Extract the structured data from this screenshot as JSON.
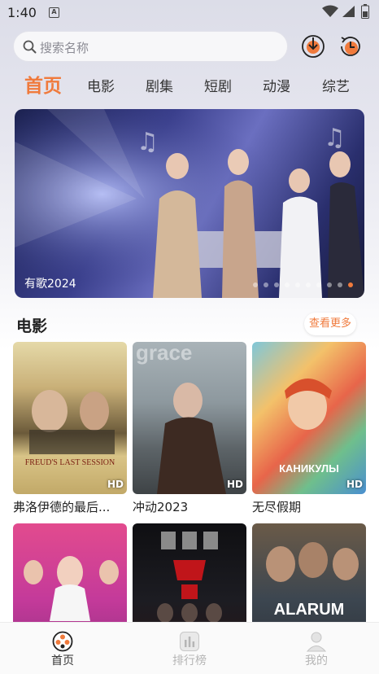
{
  "status_bar": {
    "time": "1:40",
    "notification_icon": "A"
  },
  "search": {
    "placeholder": "搜索名称"
  },
  "header_buttons": [
    "download-icon",
    "history-icon"
  ],
  "tabs": [
    {
      "label": "首页",
      "active": true
    },
    {
      "label": "电影"
    },
    {
      "label": "剧集"
    },
    {
      "label": "短剧"
    },
    {
      "label": "动漫"
    },
    {
      "label": "综艺"
    }
  ],
  "banner": {
    "title": "有歌2024",
    "dot_count": 10,
    "active_dot": 9
  },
  "section": {
    "title": "电影",
    "more_label": "查看更多"
  },
  "movies": [
    {
      "title": "弗洛伊德的最后...",
      "badge": "HD",
      "poster_text": "FREUD'S LAST SESSION"
    },
    {
      "title": "冲动2023",
      "badge": "HD",
      "poster_text": "grace"
    },
    {
      "title": "无尽假期",
      "badge": "HD",
      "poster_text": "КАНИКУЛЫ"
    },
    {
      "title": "",
      "badge": ""
    },
    {
      "title": "",
      "badge": ""
    },
    {
      "title": "",
      "badge": "",
      "poster_text": "ALARUM"
    }
  ],
  "bottom_nav": [
    {
      "label": "首页",
      "icon": "film-reel-icon",
      "active": true
    },
    {
      "label": "排行榜",
      "icon": "chart-icon"
    },
    {
      "label": "我的",
      "icon": "user-icon"
    }
  ],
  "colors": {
    "accent": "#f07a3c"
  }
}
